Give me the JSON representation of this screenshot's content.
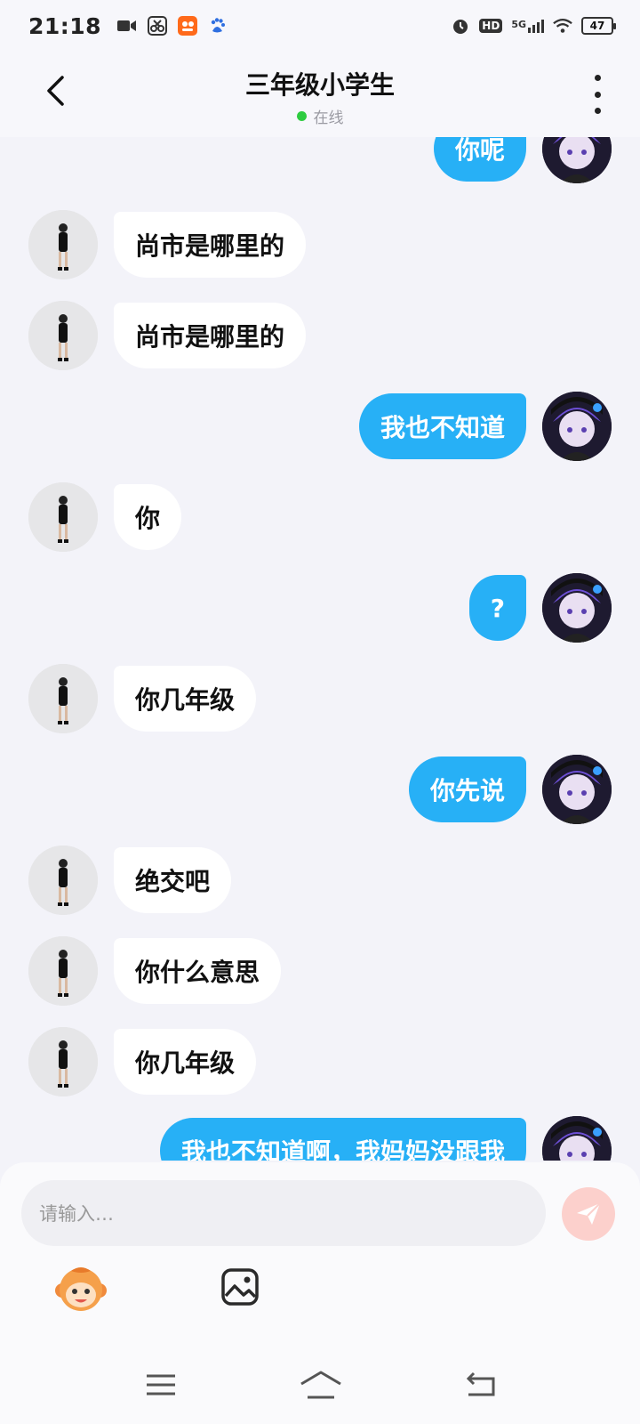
{
  "status_bar": {
    "time": "21:18",
    "hd_label": "HD",
    "network_label": "5G",
    "battery_level": "47"
  },
  "header": {
    "title": "三年级小学生",
    "status": "在线",
    "status_color": "#2ecc40"
  },
  "messages": [
    {
      "side": "right",
      "text": "你呢"
    },
    {
      "side": "left",
      "text": "尚市是哪里的"
    },
    {
      "side": "left",
      "text": "尚市是哪里的"
    },
    {
      "side": "right",
      "text": "我也不知道"
    },
    {
      "side": "left",
      "text": "你"
    },
    {
      "side": "right",
      "text": "?"
    },
    {
      "side": "left",
      "text": "你几年级"
    },
    {
      "side": "right",
      "text": "你先说"
    },
    {
      "side": "left",
      "text": "绝交吧"
    },
    {
      "side": "left",
      "text": "你什么意思"
    },
    {
      "side": "left",
      "text": "你几年级"
    },
    {
      "side": "right",
      "text": "我也不知道啊，我妈妈没跟我"
    }
  ],
  "composer": {
    "placeholder": "请输入…"
  },
  "colors": {
    "outgoing_bubble": "#27b0f6",
    "incoming_bubble": "#ffffff",
    "background": "#f3f3f9",
    "send_button": "#fcd0cc"
  },
  "icons": {
    "back": "chevron-left-icon",
    "more": "more-vertical-icon",
    "send": "paper-plane-icon",
    "emoji": "monkey-emoji-icon",
    "image": "image-icon",
    "nav_menu": "menu-icon",
    "nav_home": "home-icon",
    "nav_back": "return-icon"
  }
}
